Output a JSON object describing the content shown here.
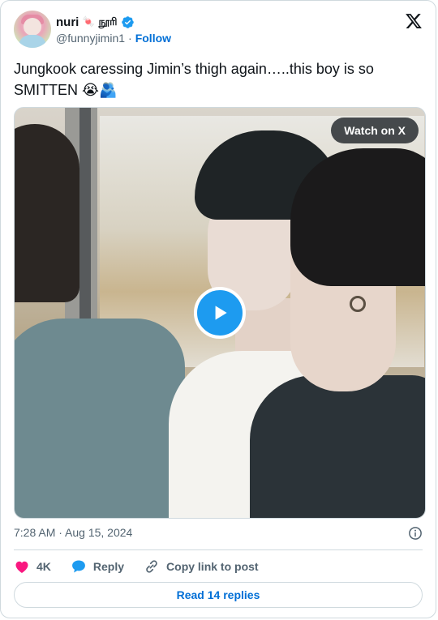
{
  "author": {
    "name": "nuri",
    "name_decoration_icon": "candy-icon",
    "name_suffix": "நூரி",
    "handle": "@funnyjimin1",
    "separator": "·",
    "follow_label": "Follow",
    "verified": true
  },
  "tweet": {
    "text": "Jungkook caressing Jimin’s thigh again…..this boy is so SMITTEN",
    "emojis": [
      "😭",
      "🫂"
    ]
  },
  "media": {
    "type": "video",
    "watch_label": "Watch on X"
  },
  "meta": {
    "timestamp": "7:28 AM · Aug 15, 2024"
  },
  "actions": {
    "like_count": "4K",
    "reply_label": "Reply",
    "copy_label": "Copy link to post"
  },
  "replies_button": "Read 14 replies",
  "colors": {
    "accent": "#1d9bf0",
    "link": "#006fd6",
    "like": "#f91880",
    "muted": "#536471",
    "border": "#cfd9de"
  }
}
